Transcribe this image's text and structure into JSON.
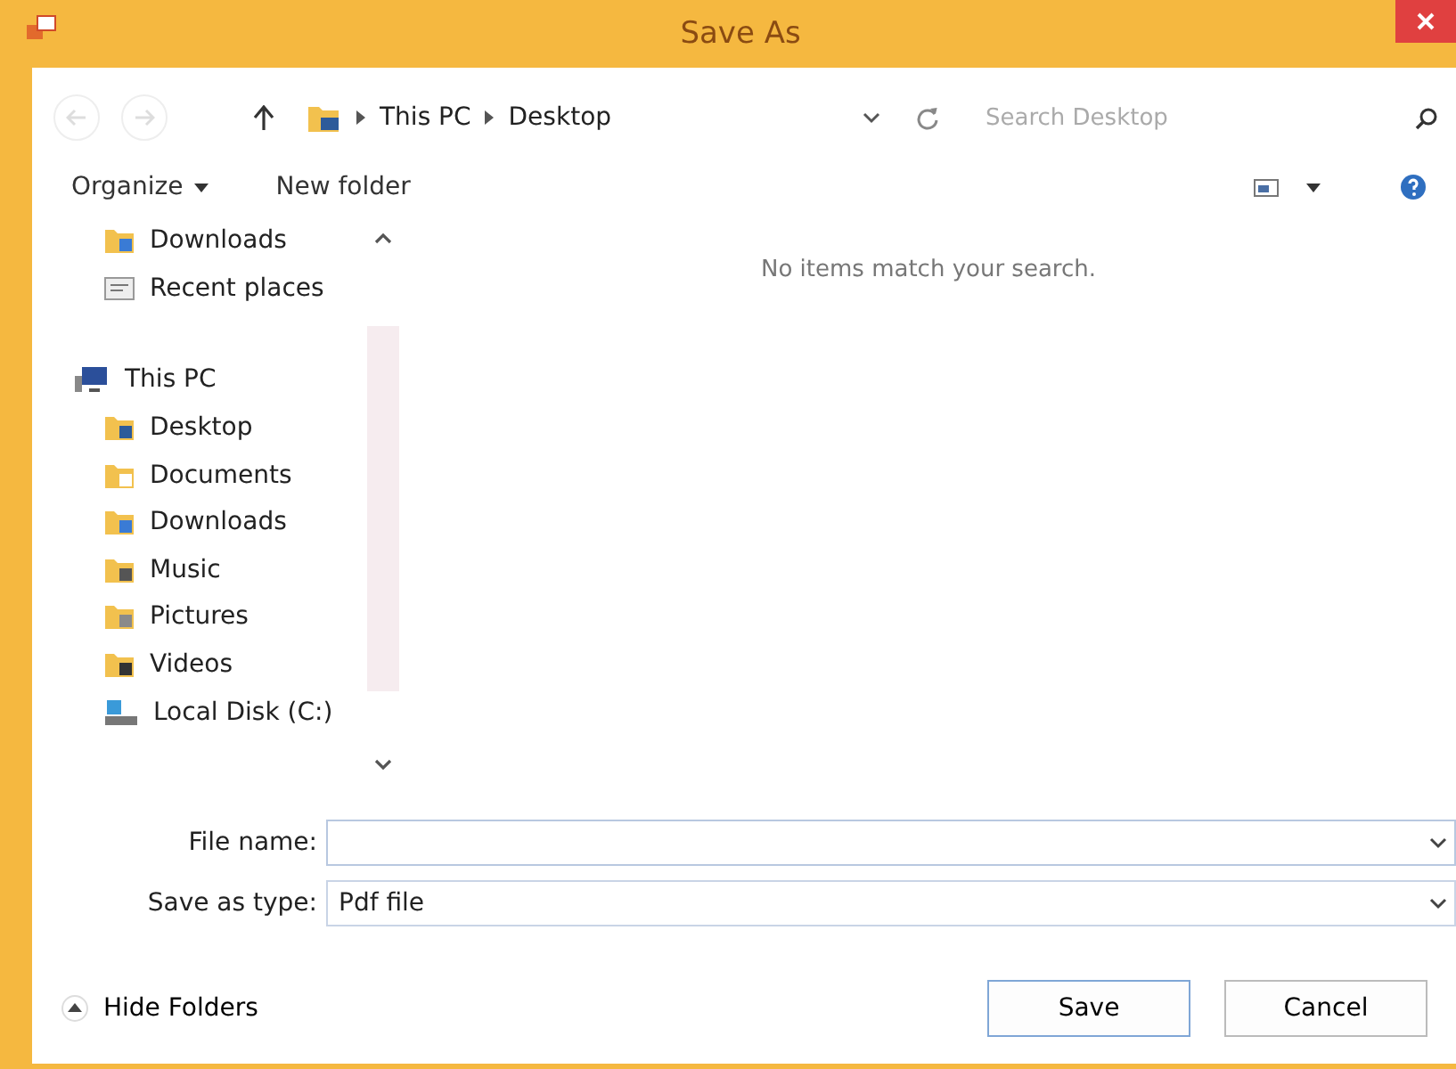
{
  "window": {
    "title": "Save As"
  },
  "address_bar": {
    "path": [
      "This PC",
      "Desktop"
    ]
  },
  "search": {
    "placeholder": "Search Desktop"
  },
  "toolbar": {
    "organize": "Organize",
    "new_folder": "New folder"
  },
  "navigation": [
    {
      "label": "Downloads",
      "kind": "downloads"
    },
    {
      "label": "Recent places",
      "kind": "recent"
    },
    {
      "label": "This PC",
      "kind": "pc",
      "children": [
        {
          "label": "Desktop",
          "kind": "desktop"
        },
        {
          "label": "Documents",
          "kind": "documents"
        },
        {
          "label": "Downloads",
          "kind": "downloads"
        },
        {
          "label": "Music",
          "kind": "music"
        },
        {
          "label": "Pictures",
          "kind": "pictures"
        },
        {
          "label": "Videos",
          "kind": "videos"
        },
        {
          "label": "Local Disk (C:)",
          "kind": "disk"
        }
      ]
    }
  ],
  "content": {
    "empty_message": "No items match your search."
  },
  "file_name": {
    "label": "File name:"
  },
  "save_as_type": {
    "label": "Save as type:",
    "value": "Pdf file"
  },
  "hide_folders": "Hide Folders",
  "buttons": [
    "Save",
    "Cancel"
  ]
}
